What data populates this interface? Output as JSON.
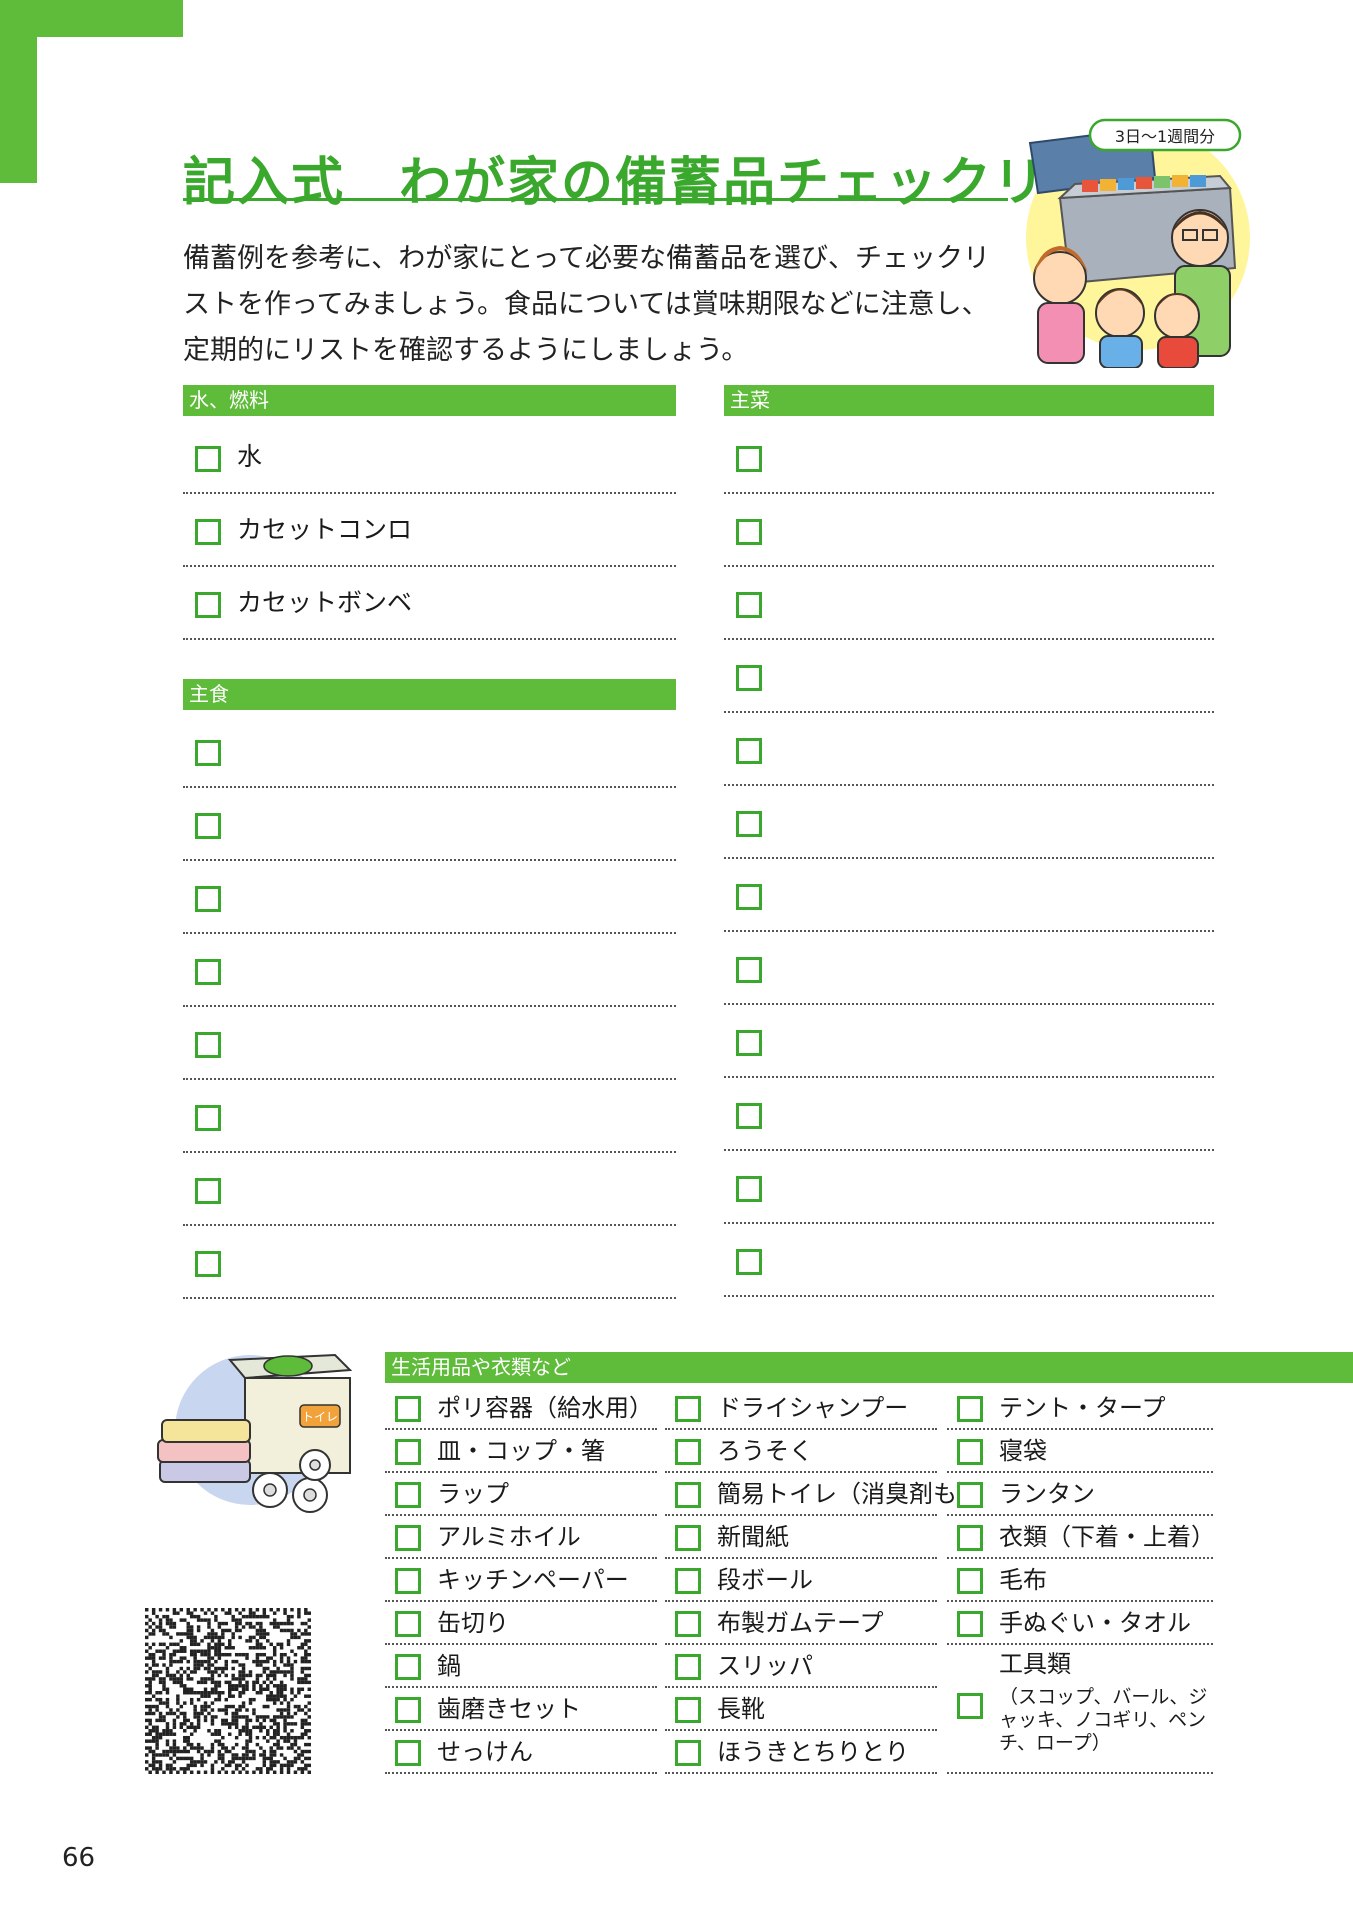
{
  "title": "記入式　わが家の備蓄品チェックリスト",
  "intro": "備蓄例を参考に、わが家にとって必要な備蓄品を選び、チェックリストを作ってみましょう。食品については賞味期限などに注意し、定期的にリストを確認するようにしましょう。",
  "illustration": {
    "bubble": "3日〜1週間分"
  },
  "water_fuel": {
    "header": "水、燃料",
    "items": [
      "水",
      "カセットコンロ",
      "カセットボンベ"
    ]
  },
  "staple": {
    "header": "主食",
    "blank_rows": 8
  },
  "main_dish": {
    "header": "主菜",
    "blank_rows": 12
  },
  "supplies": {
    "header": "生活用品や衣類など",
    "col1": [
      "ポリ容器（給水用）",
      "皿・コップ・箸",
      "ラップ",
      "アルミホイル",
      "キッチンペーパー",
      "缶切り",
      "鍋",
      "歯磨きセット",
      "せっけん"
    ],
    "col2": [
      "ドライシャンプー",
      "ろうそく",
      "簡易トイレ（消臭剤も）",
      "新聞紙",
      "段ボール",
      "布製ガムテープ",
      "スリッパ",
      "長靴",
      "ほうきとちりとり"
    ],
    "col3": [
      "テント・タープ",
      "寝袋",
      "ランタン",
      "衣類（下着・上着）",
      "毛布",
      "手ぬぐい・タオル"
    ],
    "tools": {
      "name": "工具類",
      "desc": "（スコップ、バール、ジャッキ、ノコギリ、ペンチ、ロープ）"
    },
    "toilet_box_label": "トイレ"
  },
  "page_number": "66",
  "colors": {
    "accent": "#5fbb3a",
    "title": "#3aa82c"
  }
}
